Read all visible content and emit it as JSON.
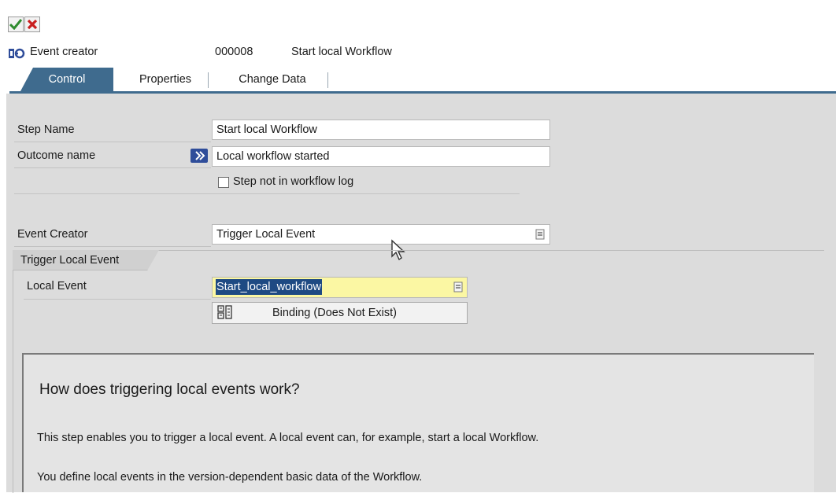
{
  "toolbar": {
    "confirm_icon": "checkmark-icon",
    "cancel_icon": "cancel-x-icon"
  },
  "header": {
    "icon": "event-creator-icon",
    "label": "Event creator",
    "step_number": "000008",
    "step_title": "Start local Workflow"
  },
  "tabs": [
    {
      "label": "Control",
      "active": true
    },
    {
      "label": "Properties",
      "active": false
    },
    {
      "label": "Change Data",
      "active": false
    }
  ],
  "form": {
    "step_name_label": "Step Name",
    "step_name_value": "Start local Workflow",
    "outcome_name_label": "Outcome name",
    "outcome_name_value": "Local workflow started",
    "outcome_icon": "outcome-arrow-icon",
    "not_in_log_label": "Step not in workflow log",
    "not_in_log_checked": false,
    "event_creator_label": "Event Creator",
    "event_creator_value": "Trigger Local Event"
  },
  "group": {
    "title": "Trigger Local Event",
    "local_event_label": "Local Event",
    "local_event_value": "Start_local_workflow",
    "binding_label": "Binding (Does Not Exist)",
    "binding_icon": "binding-icon"
  },
  "help": {
    "title": "How does triggering local events work?",
    "para1": "This step enables you to trigger a local event. A local event can, for example, start a local Workflow.",
    "para2": "You define local events in the version-dependent basic data of the Workflow."
  },
  "colors": {
    "tab_active": "#3f6b8e",
    "panel_bg": "#dcdcdc",
    "focused_field_bg": "#fbf7a3",
    "selection_bg": "#1e4a83"
  }
}
